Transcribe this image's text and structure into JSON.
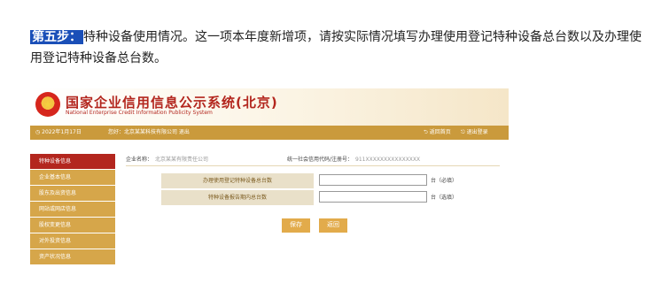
{
  "intro": {
    "step_label": "第五步：",
    "text": "特种设备使用情况。这一项本年度新增项，请按实际情况填写办理使用登记特种设备总台数以及办理使用登记特种设备总台数。"
  },
  "header": {
    "title": "国家企业信用信息公示系统(北京)",
    "subtitle": "National Enterprise Credit Information Publicity System",
    "emblem_icon": "national-emblem"
  },
  "topbar": {
    "date": "2022年1月17日",
    "welcome": "您好：北京某某科技有限公司  退出",
    "link1": "返回首页",
    "link2": "退出登录"
  },
  "sidebar": {
    "items": [
      {
        "label": "特种设备信息",
        "active": true
      },
      {
        "label": "企业基本信息",
        "active": false
      },
      {
        "label": "股东及出资信息",
        "active": false
      },
      {
        "label": "网站或网店信息",
        "active": false
      },
      {
        "label": "股权变更信息",
        "active": false
      },
      {
        "label": "对外投资信息",
        "active": false
      },
      {
        "label": "资产状况信息",
        "active": false
      }
    ]
  },
  "company": {
    "name_label": "企业名称：",
    "name_value": "北京某某有限责任公司",
    "credit_label": "统一社会信用代码/注册号：",
    "credit_value": "911XXXXXXXXXXXXXXX"
  },
  "form": {
    "rows": [
      {
        "label": "办理使用登记特种设备总台数",
        "value": "",
        "unit": "台（必填）"
      },
      {
        "label": "特种设备报告期内总台数",
        "value": "",
        "unit": "台（选填）"
      }
    ],
    "save_label": "保存",
    "back_label": "返回"
  }
}
